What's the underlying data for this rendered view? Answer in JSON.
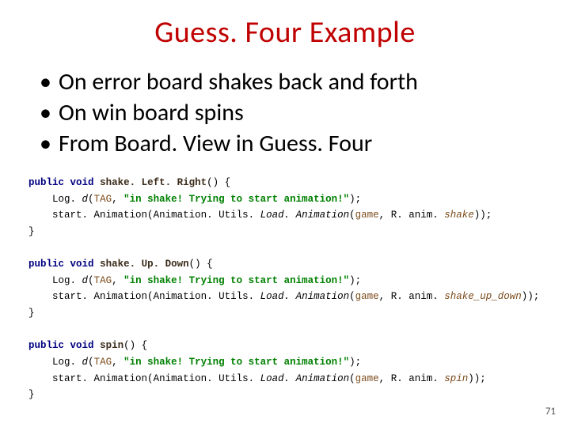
{
  "title": "Guess. Four Example",
  "bullets": [
    "On error board shakes back and forth",
    "On win board spins",
    "From Board. View in Guess. Four"
  ],
  "code": {
    "kw_public": "public",
    "kw_void": "void",
    "m1": "shake. Left. Right",
    "m2": "shake. Up. Down",
    "m3": "spin",
    "log": "Log.",
    "d": "d",
    "tag": "TAG",
    "msg": "\"in shake! Trying to start animation!\"",
    "start": "start. Animation",
    "autil": "Animation. Utils.",
    "load": "Load. Animation",
    "game": "game",
    "r": "R. anim.",
    "a1": "shake",
    "a2": "shake_up_down",
    "a3": "spin"
  },
  "page": "71"
}
